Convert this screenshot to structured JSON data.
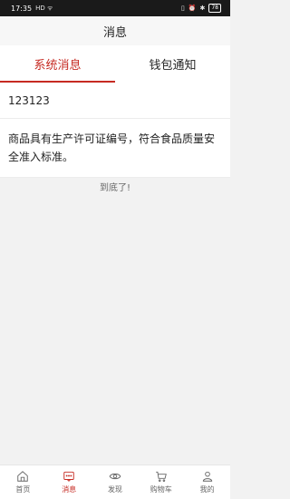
{
  "status_bar": {
    "time": "17:35",
    "left_indicators": "HD ᯤ",
    "battery": "78"
  },
  "header": {
    "title": "消息"
  },
  "tabs": [
    {
      "label": "系统消息",
      "active": true
    },
    {
      "label": "钱包通知",
      "active": false
    }
  ],
  "messages": [
    {
      "text": "123123"
    },
    {
      "text": "商品具有生产许可证编号，符合食品质量安全准入标准。"
    }
  ],
  "end_text": "到底了!",
  "bottom_nav": [
    {
      "label": "首页",
      "icon": "home-icon",
      "active": false
    },
    {
      "label": "消息",
      "icon": "message-icon",
      "active": true
    },
    {
      "label": "发现",
      "icon": "eye-icon",
      "active": false
    },
    {
      "label": "购物车",
      "icon": "cart-icon",
      "active": false
    },
    {
      "label": "我的",
      "icon": "user-icon",
      "active": false
    }
  ],
  "colors": {
    "accent": "#c62a22",
    "background": "#f2f2f2"
  }
}
